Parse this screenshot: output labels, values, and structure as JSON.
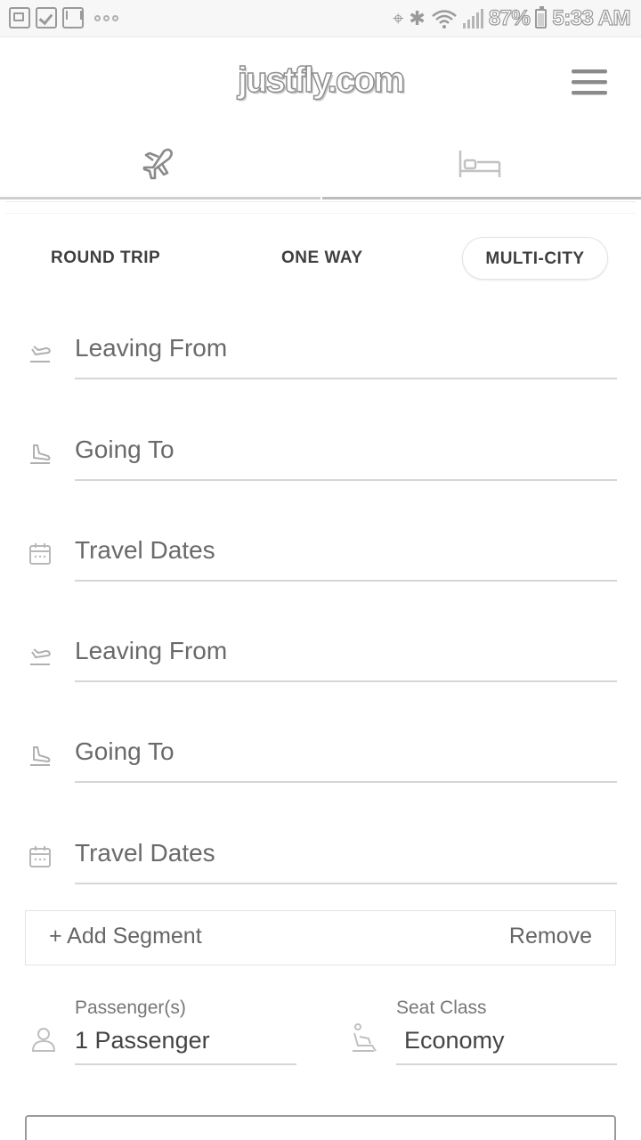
{
  "status_bar": {
    "battery": "87%",
    "time": "5:33 AM"
  },
  "header": {
    "logo": "justfly.com"
  },
  "tabs": [
    {
      "name": "flights",
      "icon": "airplane-icon"
    },
    {
      "name": "hotels",
      "icon": "bed-icon"
    }
  ],
  "trip_types": {
    "round_trip": "ROUND TRIP",
    "one_way": "ONE WAY",
    "multi_city": "MULTI-CITY",
    "selected": "MULTI-CITY"
  },
  "segments": [
    {
      "leaving_from": "Leaving From",
      "going_to": "Going To",
      "travel_dates": "Travel Dates"
    },
    {
      "leaving_from": "Leaving From",
      "going_to": "Going To",
      "travel_dates": "Travel Dates"
    }
  ],
  "segment_actions": {
    "add": "+ Add Segment",
    "remove": "Remove"
  },
  "passengers": {
    "label": "Passenger(s)",
    "value": "1 Passenger"
  },
  "seat_class": {
    "label": "Seat Class",
    "value": "Economy"
  },
  "colors": {
    "text": "#555555",
    "divider": "#d6d6d6",
    "background": "#ffffff"
  }
}
